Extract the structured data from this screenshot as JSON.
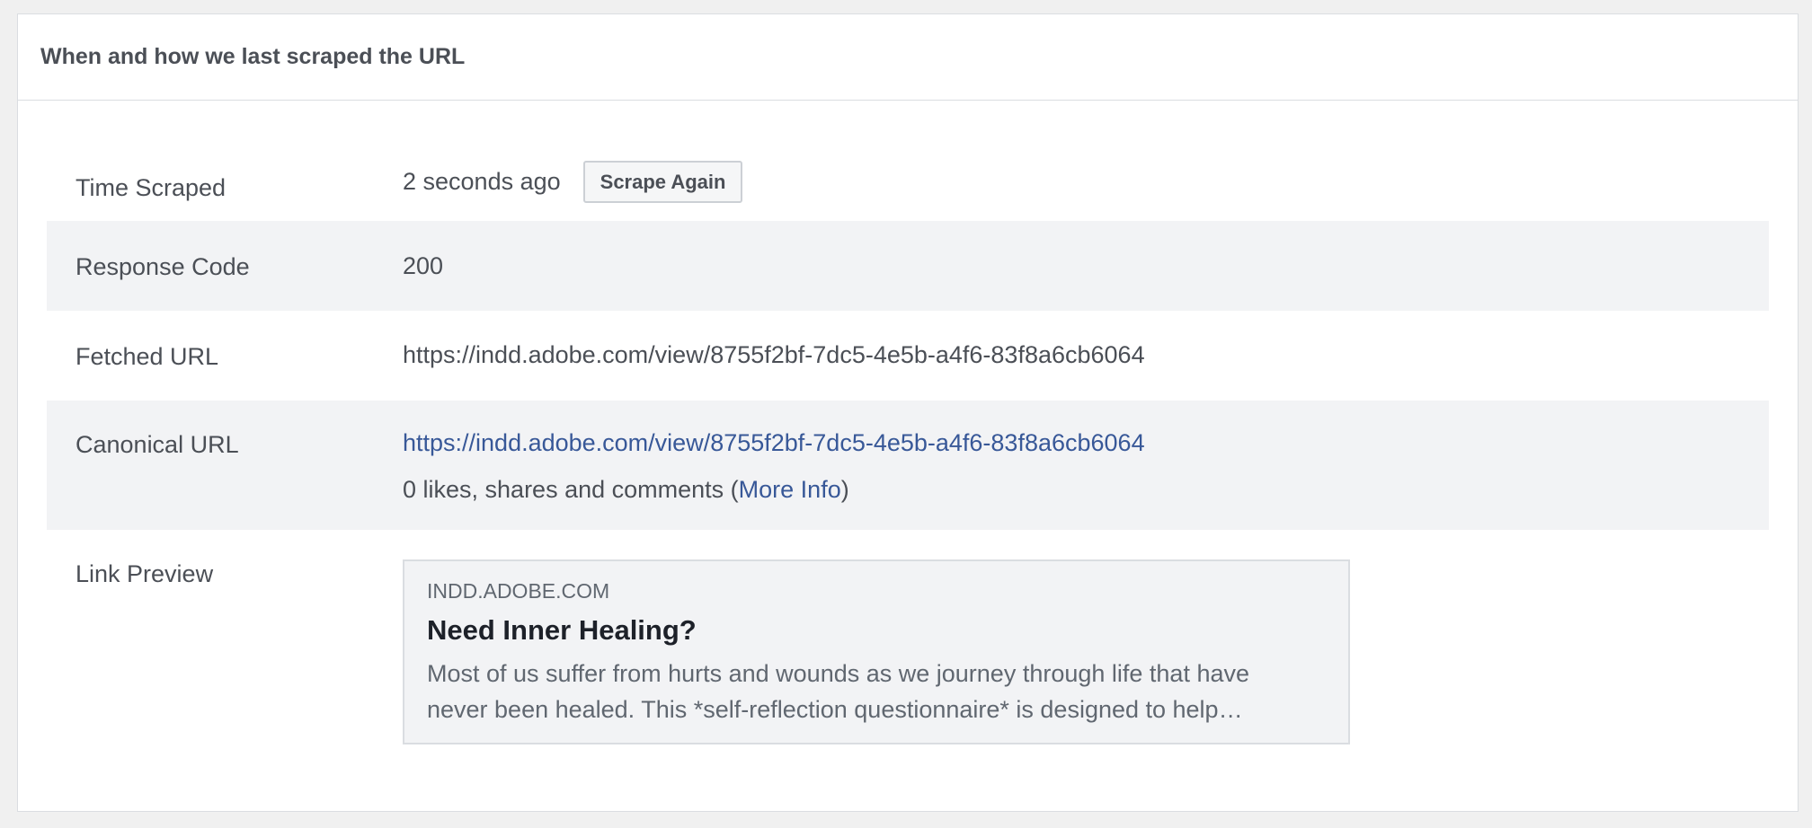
{
  "panel": {
    "title": "When and how we last scraped the URL"
  },
  "rows": {
    "time_scraped": {
      "label": "Time Scraped",
      "value": "2 seconds ago",
      "button_label": "Scrape Again"
    },
    "response_code": {
      "label": "Response Code",
      "value": "200"
    },
    "fetched_url": {
      "label": "Fetched URL",
      "value": "https://indd.adobe.com/view/8755f2bf-7dc5-4e5b-a4f6-83f8a6cb6064"
    },
    "canonical_url": {
      "label": "Canonical URL",
      "value": "https://indd.adobe.com/view/8755f2bf-7dc5-4e5b-a4f6-83f8a6cb6064",
      "engagement_prefix": "0 likes, shares and comments (",
      "more_info_link": "More Info",
      "engagement_suffix": ")"
    },
    "link_preview": {
      "label": "Link Preview",
      "domain": "INDD.ADOBE.COM",
      "title": "Need Inner Healing?",
      "description": "Most of us suffer from hurts and wounds as we journey through life that have never been healed. This *self-reflection questionnaire* is designed to help…"
    }
  },
  "colors": {
    "link": "#385898",
    "shaded_row": "#f2f3f5",
    "border": "#dadde1"
  }
}
